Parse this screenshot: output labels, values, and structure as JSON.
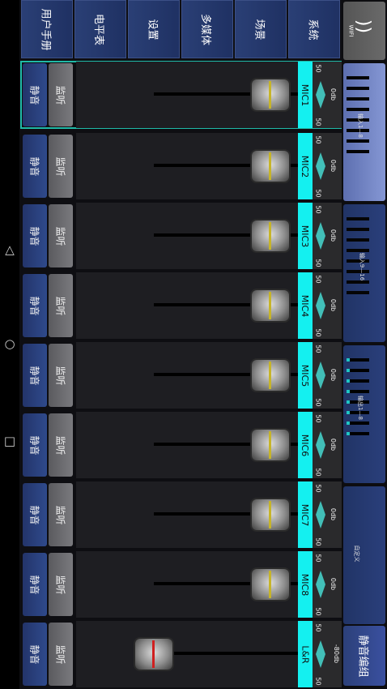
{
  "navigation": {
    "triangle": "△",
    "circle": "○",
    "square": "□"
  },
  "menu": [
    {
      "label": "用户手册"
    },
    {
      "label": "电平表"
    },
    {
      "label": "设置"
    },
    {
      "label": "多媒体"
    },
    {
      "label": "场景"
    },
    {
      "label": "系统"
    }
  ],
  "side_panel": {
    "wifi_label": "WIFI",
    "groups": [
      {
        "label": "输入1—8"
      },
      {
        "label": "输入9—16"
      },
      {
        "label": "输出1—8"
      },
      {
        "label": "自定义"
      }
    ],
    "mute_group_label": "静音编组"
  },
  "channels": [
    {
      "id": "MIC1",
      "tab": "MIC1",
      "mute": "静音",
      "monitor": "监听",
      "pan_left": "50",
      "pan_right": "50",
      "level": "0db",
      "fader_level": 0.78
    },
    {
      "id": "MIC2",
      "tab": "MIC2",
      "mute": "静音",
      "monitor": "监听",
      "pan_left": "50",
      "pan_right": "50",
      "level": "0db",
      "fader_level": 0.78
    },
    {
      "id": "MIC3",
      "tab": "MIC3",
      "mute": "静音",
      "monitor": "监听",
      "pan_left": "50",
      "pan_right": "50",
      "level": "0db",
      "fader_level": 0.78
    },
    {
      "id": "MIC4",
      "tab": "MIC4",
      "mute": "静音",
      "monitor": "监听",
      "pan_left": "50",
      "pan_right": "50",
      "level": "0db",
      "fader_level": 0.78
    },
    {
      "id": "MIC5",
      "tab": "MIC5",
      "mute": "静音",
      "monitor": "监听",
      "pan_left": "50",
      "pan_right": "50",
      "level": "0db",
      "fader_level": 0.78
    },
    {
      "id": "MIC6",
      "tab": "MIC6",
      "mute": "静音",
      "monitor": "监听",
      "pan_left": "50",
      "pan_right": "50",
      "level": "0db",
      "fader_level": 0.78
    },
    {
      "id": "MIC7",
      "tab": "MIC7",
      "mute": "静音",
      "monitor": "监听",
      "pan_left": "50",
      "pan_right": "50",
      "level": "0db",
      "fader_level": 0.78
    },
    {
      "id": "MIC8",
      "tab": "MIC8",
      "mute": "静音",
      "monitor": "监听",
      "pan_left": "50",
      "pan_right": "50",
      "level": "0db",
      "fader_level": 0.78
    },
    {
      "id": "L&R",
      "tab": "L&R",
      "mute": "静音",
      "monitor": "监听",
      "pan_left": "50",
      "pan_right": "50",
      "level": "-80db",
      "fader_level": 0.0
    }
  ]
}
